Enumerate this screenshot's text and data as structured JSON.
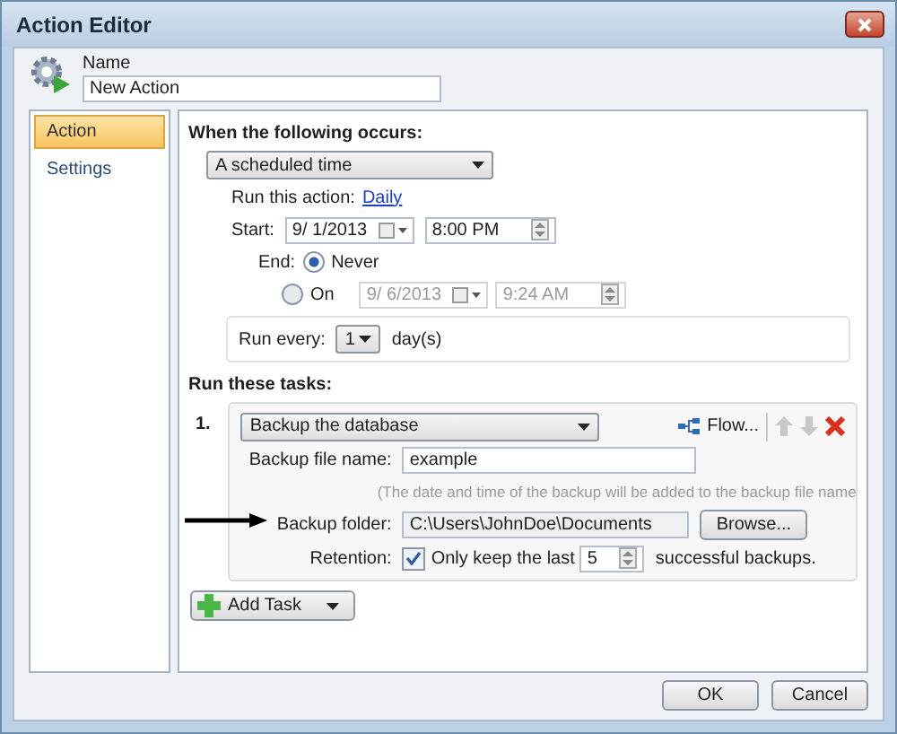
{
  "window": {
    "title": "Action Editor"
  },
  "name": {
    "label": "Name",
    "value": "New Action"
  },
  "sidebar": {
    "items": [
      {
        "label": "Action",
        "selected": true
      },
      {
        "label": "Settings",
        "selected": false
      }
    ]
  },
  "trigger": {
    "heading": "When the following occurs:",
    "event": "A scheduled time",
    "run_label": "Run this action:",
    "run_link": "Daily",
    "start": {
      "label": "Start:",
      "date": "9/ 1/2013",
      "time": "8:00 PM"
    },
    "end": {
      "label": "End:",
      "options": [
        {
          "label": "Never",
          "selected": true
        },
        {
          "label": "On",
          "selected": false,
          "date": "9/ 6/2013",
          "time": "9:24 AM"
        }
      ]
    },
    "run_every": {
      "label": "Run every:",
      "value": "1",
      "unit": "day(s)"
    }
  },
  "tasks": {
    "heading": "Run these tasks:",
    "items": [
      {
        "number": "1.",
        "type": "Backup the database",
        "flow": "Flow...",
        "file_label": "Backup file name:",
        "file_value": "example",
        "hint": "(The date and time of the backup will be added to the backup file name",
        "folder_label": "Backup folder:",
        "folder_value": "C:\\Users\\JohnDoe\\Documents",
        "browse": "Browse...",
        "retention_label": "Retention:",
        "retention_checked": true,
        "retention_text": "Only keep the last",
        "retention_count": "5",
        "retention_suffix": "successful backups."
      }
    ]
  },
  "add_task": "Add Task",
  "buttons": [
    "OK",
    "Cancel"
  ]
}
